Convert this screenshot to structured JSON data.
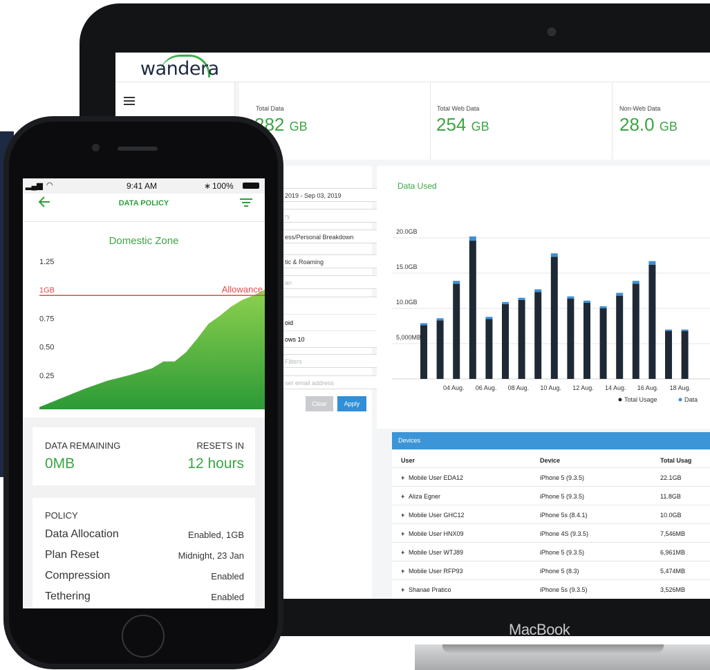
{
  "laptop": {
    "brand": "MacBook"
  },
  "web": {
    "logo": "wandera",
    "stats": [
      {
        "label": "Total Data",
        "value": "282",
        "unit": "GB"
      },
      {
        "label": "Total Web Data",
        "value": "254",
        "unit": "GB"
      },
      {
        "label": "Non-Web Data",
        "value": "28.0",
        "unit": "GB"
      }
    ],
    "filters": {
      "date_range": "2019 - Sep 03, 2019",
      "f2": "ry",
      "breakdown": "ess/Personal Breakdown",
      "roaming": "tic & Roaming",
      "f5": "an",
      "os1": "oid",
      "os2": "ows 10",
      "more_filters": "Filters",
      "email_placeholder": "ser email address",
      "clear": "Clear",
      "apply": "Apply"
    },
    "chart_title": "Data Used",
    "legend": {
      "total": "Total Usage",
      "data": "Data"
    },
    "devices": {
      "title": "Devices",
      "headers": {
        "user": "User",
        "device": "Device",
        "usage": "Total Usag"
      },
      "rows": [
        {
          "user": "Mobile User EDA12",
          "device": "iPhone 5 (9.3.5)",
          "usage": "22.1GB"
        },
        {
          "user": "Aliza Egner",
          "device": "iPhone 5 (9.3.5)",
          "usage": "11.8GB"
        },
        {
          "user": "Mobile User GHC12",
          "device": "iPhone 5s (8.4.1)",
          "usage": "10.0GB"
        },
        {
          "user": "Mobile User HNX09",
          "device": "iPhone 4S (9.3.5)",
          "usage": "7,546MB"
        },
        {
          "user": "Mobile User WTJ89",
          "device": "iPhone 5 (9.3.5)",
          "usage": "6,961MB"
        },
        {
          "user": "Mobile User RFP93",
          "device": "iPhone 5 (8.3)",
          "usage": "5,474MB"
        },
        {
          "user": "Shanae Pratico",
          "device": "iPhone 5s (9.3.5)",
          "usage": "3,526MB"
        }
      ]
    }
  },
  "chart_data": [
    {
      "type": "bar",
      "title": "Data Used",
      "y_tick_labels": [
        "5,000MB",
        "10.0GB",
        "15.0GB",
        "20.0GB"
      ],
      "x_tick_labels": [
        "04 Aug.",
        "06 Aug.",
        "08 Aug.",
        "10 Aug.",
        "12 Aug.",
        "14 Aug.",
        "16 Aug.",
        "18 Aug."
      ],
      "ylim_gb": [
        0,
        20
      ],
      "series": [
        {
          "name": "Total Usage",
          "values": [
            7.6,
            8.3,
            13.5,
            19.6,
            8.5,
            10.6,
            11.2,
            12.3,
            17.3,
            11.4,
            10.8,
            10.0,
            11.8,
            13.5,
            16.2,
            6.8,
            6.8
          ]
        },
        {
          "name": "Data",
          "values": [
            0.3,
            0.3,
            0.4,
            0.6,
            0.3,
            0.3,
            0.3,
            0.4,
            0.5,
            0.3,
            0.3,
            0.3,
            0.4,
            0.4,
            0.5,
            0.2,
            0.2
          ]
        }
      ],
      "colors": {
        "total": "#1f2935",
        "data": "#3b8fd6"
      },
      "legend": "bottom-right",
      "grid": true
    },
    {
      "type": "area",
      "title": "Domestic Zone",
      "y_tick_labels": [
        "0.25",
        "0.50",
        "0.75",
        "1GB",
        "1.25"
      ],
      "ylim": [
        0,
        1.25
      ],
      "allowance": 1.0,
      "allowance_label": "Allowance",
      "x": [
        0,
        0.1,
        0.2,
        0.3,
        0.4,
        0.5,
        0.55,
        0.6,
        0.65,
        0.7,
        0.75,
        0.8,
        0.85,
        0.9,
        0.95,
        1.0
      ],
      "values": [
        0.02,
        0.1,
        0.18,
        0.25,
        0.3,
        0.36,
        0.42,
        0.42,
        0.5,
        0.62,
        0.75,
        0.82,
        0.9,
        0.96,
        1.0,
        1.05
      ],
      "colors": {
        "fill_top": "#8ed14f",
        "fill_bottom": "#2c9a36",
        "allowance": "#e04a4a"
      }
    }
  ],
  "phone": {
    "status": {
      "time": "9:41 AM",
      "battery": "100%"
    },
    "title": "DATA POLICY",
    "zone_title": "Domestic Zone",
    "remaining_label": "DATA REMAINING",
    "remaining_value": "0MB",
    "resets_label": "RESETS IN",
    "resets_value": "12 hours",
    "policy_label": "POLICY",
    "policy_rows": [
      {
        "label": "Data Allocation",
        "value": "Enabled, 1GB"
      },
      {
        "label": "Plan Reset",
        "value": "Midnight, 23 Jan"
      },
      {
        "label": "Compression",
        "value": "Enabled"
      },
      {
        "label": "Tethering",
        "value": "Enabled"
      }
    ]
  }
}
